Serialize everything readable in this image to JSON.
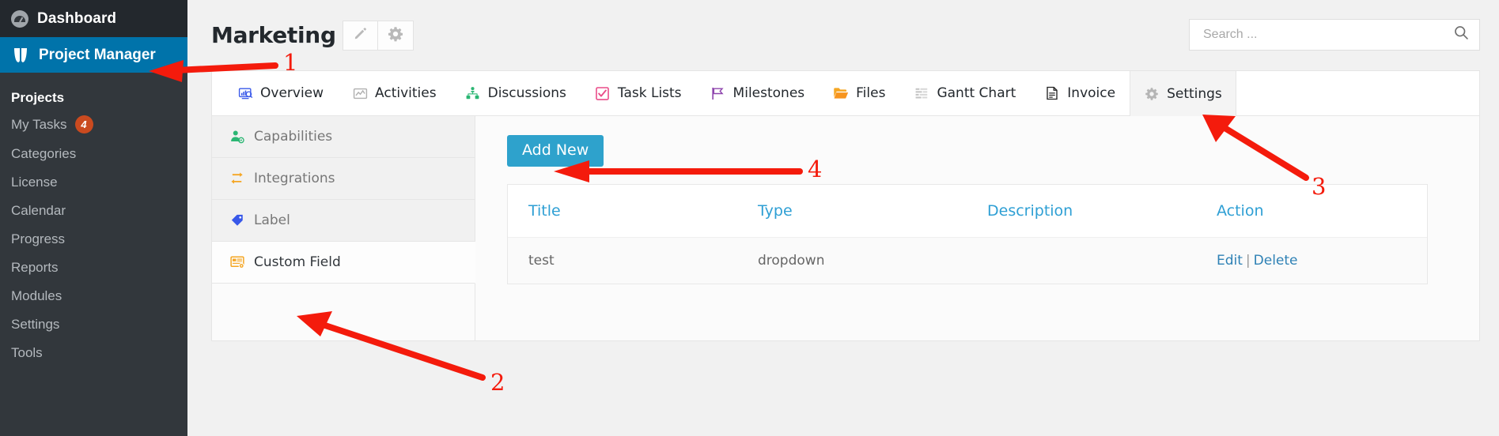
{
  "sidebar": {
    "top_items": [
      {
        "label": "Dashboard",
        "icon": "dashboard-icon"
      },
      {
        "label": "Project Manager",
        "icon": "project-manager-icon",
        "active": true
      }
    ],
    "section_heading": "Projects",
    "items": [
      {
        "label": "My Tasks",
        "badge": "4"
      },
      {
        "label": "Categories",
        "badge": ""
      },
      {
        "label": "License",
        "badge": ""
      },
      {
        "label": "Calendar",
        "badge": ""
      },
      {
        "label": "Progress",
        "badge": ""
      },
      {
        "label": "Reports",
        "badge": ""
      },
      {
        "label": "Modules",
        "badge": ""
      },
      {
        "label": "Settings",
        "badge": ""
      },
      {
        "label": "Tools",
        "badge": ""
      }
    ],
    "colors": {
      "bg": "#32373c",
      "active": "#0073aa",
      "badge": "#ca4a1f"
    }
  },
  "header": {
    "title": "Marketing",
    "edit_button_icon": "pencil-icon",
    "settings_button_icon": "gear-icon"
  },
  "search": {
    "value": "",
    "placeholder": "Search ...",
    "icon": "search-icon"
  },
  "tabs": [
    {
      "label": "Overview",
      "icon": "chart-monitor-icon",
      "active": false
    },
    {
      "label": "Activities",
      "icon": "activity-image-icon",
      "active": false
    },
    {
      "label": "Discussions",
      "icon": "users-group-icon",
      "active": false
    },
    {
      "label": "Task Lists",
      "icon": "checkbox-icon",
      "active": false
    },
    {
      "label": "Milestones",
      "icon": "flag-icon",
      "active": false
    },
    {
      "label": "Files",
      "icon": "folder-open-icon",
      "active": false
    },
    {
      "label": "Gantt Chart",
      "icon": "gantt-bars-icon",
      "active": false
    },
    {
      "label": "Invoice",
      "icon": "invoice-doc-icon",
      "active": false
    },
    {
      "label": "Settings",
      "icon": "gear-icon",
      "active": true
    }
  ],
  "subnav": [
    {
      "label": "Capabilities",
      "icon": "user-cog-icon",
      "active": false
    },
    {
      "label": "Integrations",
      "icon": "sync-arrows-icon",
      "active": false
    },
    {
      "label": "Label",
      "icon": "tag-icon",
      "active": false
    },
    {
      "label": "Custom Field",
      "icon": "custom-field-icon",
      "active": true
    }
  ],
  "content": {
    "add_new_label": "Add New",
    "table": {
      "headers": [
        "Title",
        "Type",
        "Description",
        "Action"
      ],
      "rows": [
        {
          "title": "test",
          "type": "dropdown",
          "description": "",
          "actions": {
            "edit": "Edit",
            "separator": "|",
            "delete": "Delete"
          }
        }
      ]
    }
  },
  "annotations": {
    "color": "#f41b0c",
    "markers": [
      {
        "number": "1",
        "target": "project-manager-sidebar-item"
      },
      {
        "number": "2",
        "target": "subnav-custom-field"
      },
      {
        "number": "3",
        "target": "tab-settings"
      },
      {
        "number": "4",
        "target": "add-new-button"
      }
    ]
  }
}
